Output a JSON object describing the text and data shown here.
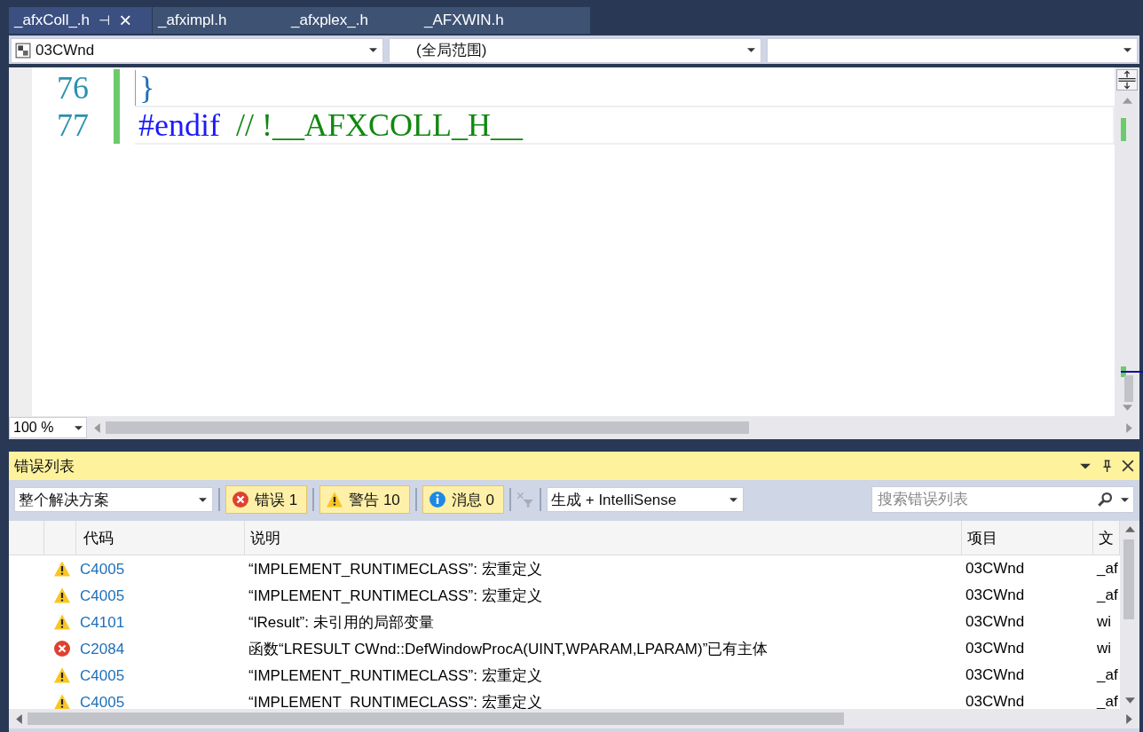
{
  "tabs": [
    {
      "label": "_afxColl_.h",
      "selected": true,
      "pin": "⊣",
      "close": "×"
    },
    {
      "label": "_afximpl.h",
      "selected": false
    },
    {
      "label": "_afxplex_.h",
      "selected": false
    },
    {
      "label": "_AFXWIN.h",
      "selected": false
    }
  ],
  "nav_bar": {
    "project": "03CWnd",
    "scope": "(全局范围)"
  },
  "editor": {
    "lines": [
      {
        "number": "76",
        "kind": "brace",
        "text": "}"
      },
      {
        "number": "77",
        "kind": "directive",
        "keyword": "#endif",
        "comment": "// !__AFXCOLL_H__"
      }
    ],
    "zoom": "100 %"
  },
  "error_list": {
    "title": "错误列表",
    "scope": "整个解决方案",
    "filters": [
      {
        "kind": "error",
        "label": "错误 1",
        "on": true
      },
      {
        "kind": "warning",
        "label": "警告 10",
        "on": true
      },
      {
        "kind": "info",
        "label": "消息 0",
        "on": true
      }
    ],
    "source": "生成 + IntelliSense",
    "search": {
      "placeholder": "搜索错误列表"
    },
    "columns": [
      "代码",
      "说明",
      "项目",
      "文"
    ],
    "rows": [
      {
        "kind": "warning",
        "code": "C4005",
        "description": "“IMPLEMENT_RUNTIMECLASS”: 宏重定义",
        "project": "03CWnd",
        "file": "_af"
      },
      {
        "kind": "warning",
        "code": "C4005",
        "description": "“IMPLEMENT_RUNTIMECLASS”: 宏重定义",
        "project": "03CWnd",
        "file": "_af"
      },
      {
        "kind": "warning",
        "code": "C4101",
        "description": "“lResult”: 未引用的局部变量",
        "project": "03CWnd",
        "file": "wi"
      },
      {
        "kind": "error",
        "code": "C2084",
        "description": "函数“LRESULT CWnd::DefWindowProcA(UINT,WPARAM,LPARAM)”已有主体",
        "project": "03CWnd",
        "file": "wi"
      },
      {
        "kind": "warning",
        "code": "C4005",
        "description": "“IMPLEMENT_RUNTIMECLASS”: 宏重定义",
        "project": "03CWnd",
        "file": "_af"
      },
      {
        "kind": "warning",
        "code": "C4005",
        "description": "“IMPLEMENT_RUNTIMECLASS”: 宏重定义",
        "project": "03CWnd",
        "file": "_af"
      }
    ]
  }
}
